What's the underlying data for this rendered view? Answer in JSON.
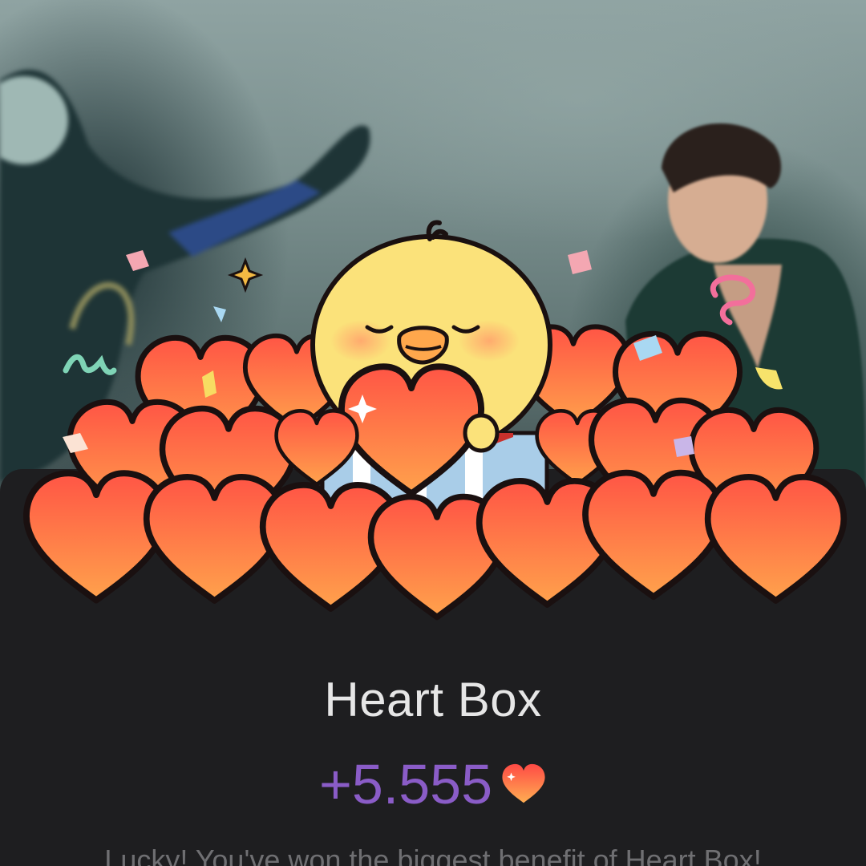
{
  "reward": {
    "title": "Heart Box",
    "amount": "+5.555",
    "message": "Lucky! You've won the biggest benefit of Heart Box!",
    "amount_color": "#8a5cc7",
    "currency_icon": "heart-icon"
  },
  "background": {
    "description_icon": "video-background"
  },
  "colors": {
    "sheet": "#1e1e20",
    "heart_top": "#ff5a4a",
    "heart_bottom": "#ffa04a",
    "chick": "#fbe27a"
  }
}
